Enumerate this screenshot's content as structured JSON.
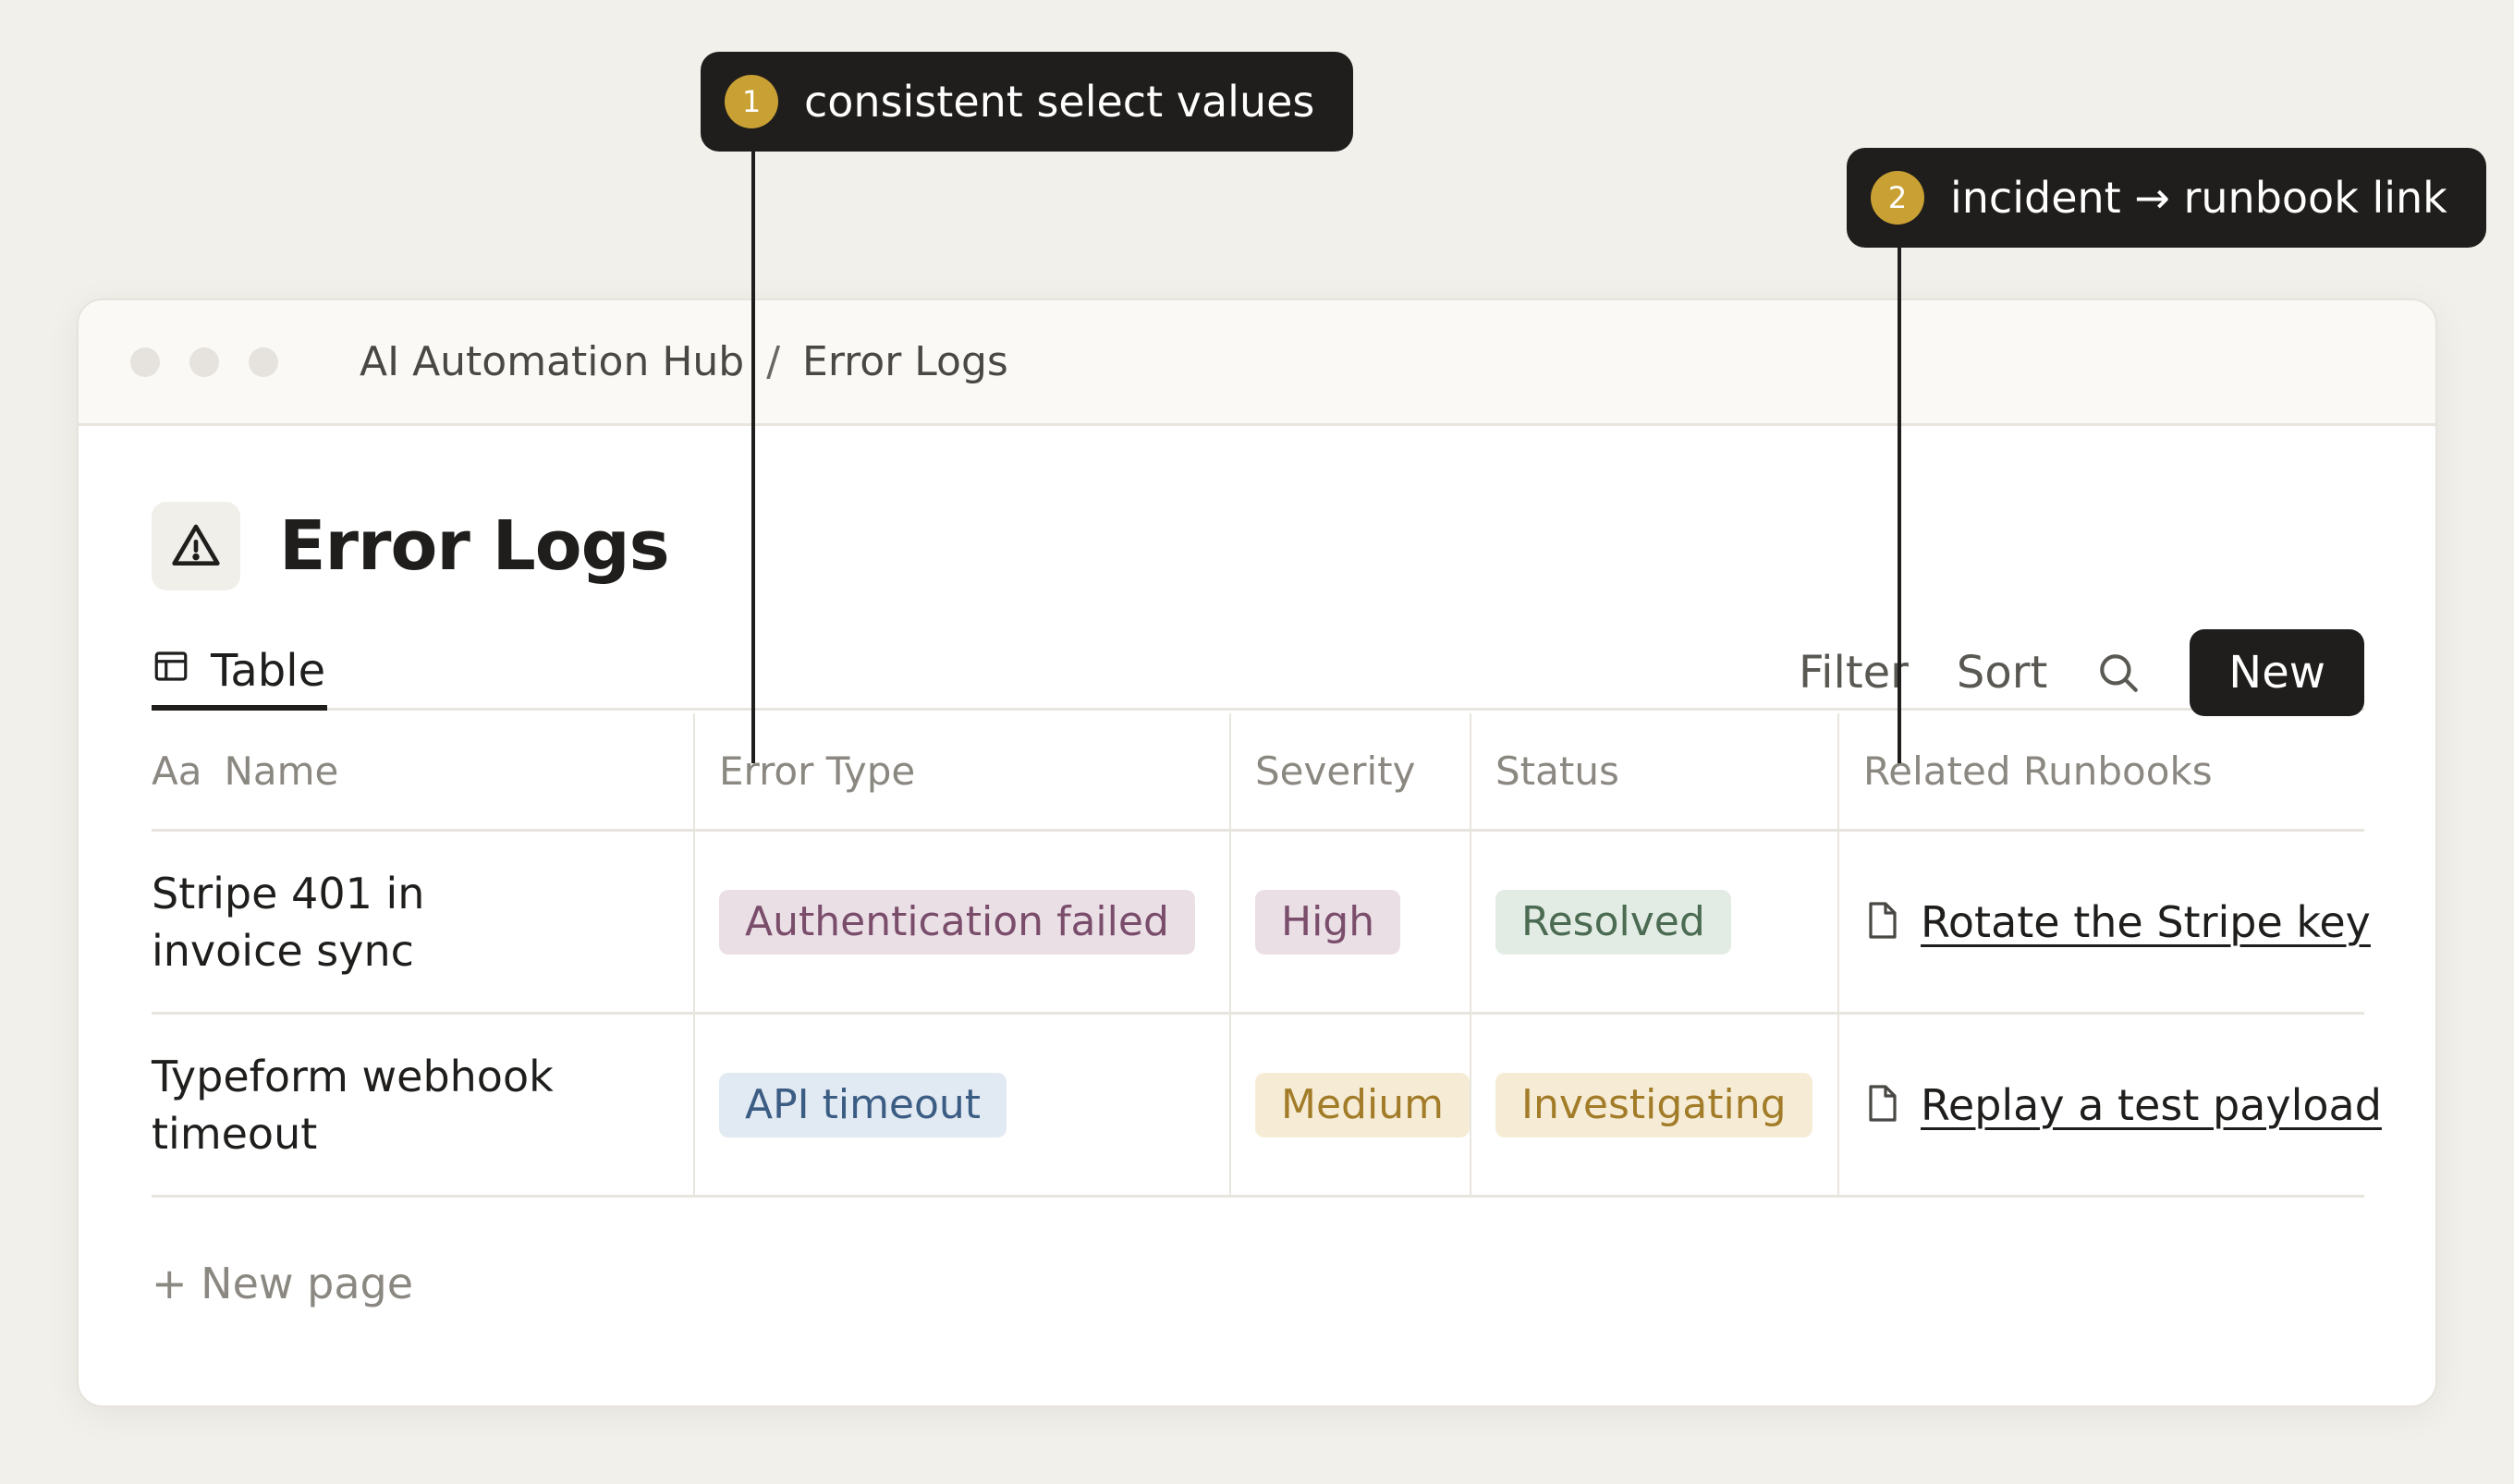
{
  "annotations": [
    {
      "number": "1",
      "text": "consistent select values"
    },
    {
      "number": "2",
      "text": "incident → runbook link"
    }
  ],
  "breadcrumb": {
    "workspace": "AI Automation Hub",
    "separator": "/",
    "page": "Error Logs"
  },
  "page": {
    "title": "Error Logs",
    "icon": "warning-triangle-icon"
  },
  "view": {
    "tab_label": "Table",
    "tab_icon": "table-icon"
  },
  "actions": {
    "filter": "Filter",
    "sort": "Sort",
    "search_icon": "search-icon",
    "new": "New"
  },
  "table": {
    "name_prefix": "Aa",
    "columns": [
      "Name",
      "Error Type",
      "Severity",
      "Status",
      "Related Runbooks"
    ],
    "rows": [
      {
        "name": "Stripe 401 in invoice sync",
        "error_type": "Authentication failed",
        "severity": "High",
        "status": "Resolved",
        "runbook": "Rotate the Stripe key"
      },
      {
        "name": "Typeform webhook timeout",
        "error_type": "API timeout",
        "severity": "Medium",
        "status": "Investigating",
        "runbook": "Replay a test payload"
      }
    ],
    "new_page": "+ New page"
  },
  "colors": {
    "tag_purple_bg": "#ebdfe6",
    "tag_purple_fg": "#7a4d6b",
    "tag_blue_bg": "#e1e9f2",
    "tag_blue_fg": "#3b5d84",
    "tag_green_bg": "#e3ece4",
    "tag_green_fg": "#4b6b52",
    "tag_yellow_bg": "#f6ecd6",
    "tag_yellow_fg": "#a27c28",
    "badge": "#c9a033"
  }
}
